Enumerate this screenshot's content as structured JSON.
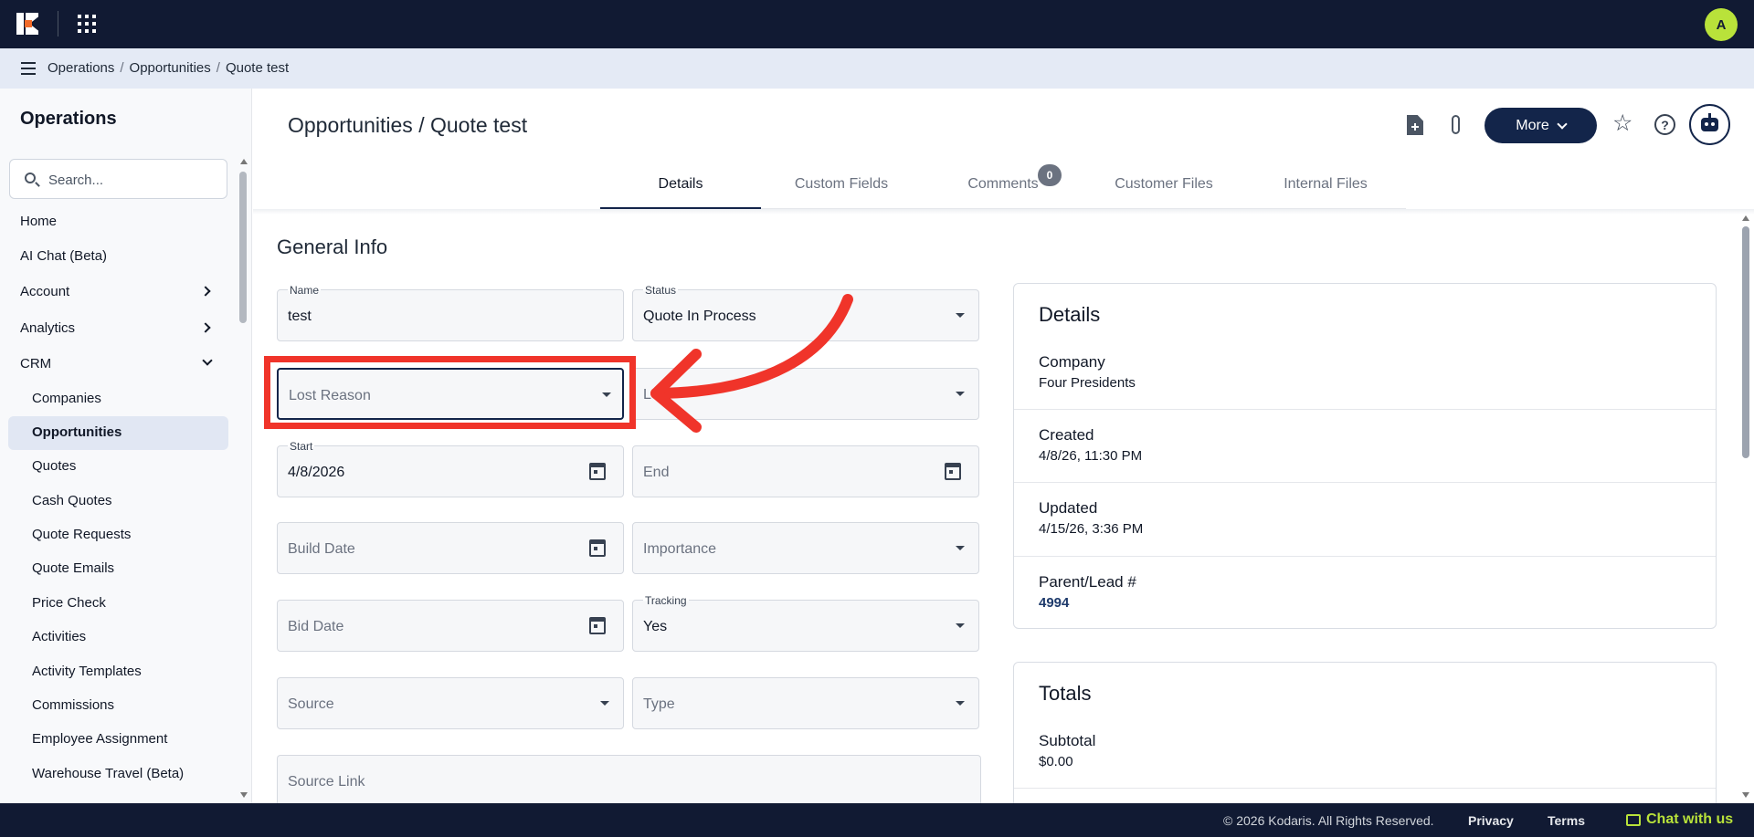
{
  "app": {
    "avatar_initial": "A"
  },
  "breadcrumb": {
    "items": [
      "Operations",
      "Opportunities",
      "Quote test"
    ],
    "sep": "/"
  },
  "sidebar": {
    "title": "Operations",
    "search_placeholder": "Search...",
    "items": [
      {
        "label": "Home"
      },
      {
        "label": "AI Chat (Beta)"
      },
      {
        "label": "Account",
        "chevron": "right"
      },
      {
        "label": "Analytics",
        "chevron": "right"
      },
      {
        "label": "CRM",
        "chevron": "down"
      }
    ],
    "crm_items": [
      "Companies",
      "Opportunities",
      "Quotes",
      "Cash Quotes",
      "Quote Requests",
      "Quote Emails",
      "Price Check",
      "Activities",
      "Activity Templates",
      "Commissions",
      "Employee Assignment",
      "Warehouse Travel (Beta)"
    ],
    "active": "Opportunities"
  },
  "header": {
    "title": "Opportunities / Quote test",
    "more_label": "More",
    "help_glyph": "?",
    "star_glyph": "☆"
  },
  "tabs": {
    "items": [
      "Details",
      "Custom Fields",
      "Comments",
      "Customer Files",
      "Internal Files"
    ],
    "active": "Details",
    "comments_count": "0"
  },
  "general_info": {
    "title": "General Info",
    "name": {
      "label": "Name",
      "value": "test"
    },
    "status": {
      "label": "Status",
      "value": "Quote In Process"
    },
    "lost_reason": {
      "placeholder": "Lost Reason"
    },
    "second_partial": {
      "placeholder": "Lo"
    },
    "start": {
      "label": "Start",
      "value": "4/8/2026"
    },
    "end": {
      "placeholder": "End"
    },
    "build_date": {
      "placeholder": "Build Date"
    },
    "importance": {
      "placeholder": "Importance"
    },
    "bid_date": {
      "placeholder": "Bid Date"
    },
    "tracking": {
      "label": "Tracking",
      "value": "Yes"
    },
    "source": {
      "placeholder": "Source"
    },
    "type": {
      "placeholder": "Type"
    },
    "source_link": {
      "placeholder": "Source Link"
    }
  },
  "details_card": {
    "title": "Details",
    "company": {
      "label": "Company",
      "value": "Four Presidents"
    },
    "created": {
      "label": "Created",
      "value": "4/8/26, 11:30 PM"
    },
    "updated": {
      "label": "Updated",
      "value": "4/15/26, 3:36 PM"
    },
    "parent": {
      "label": "Parent/Lead #",
      "value": "4994"
    }
  },
  "totals_card": {
    "title": "Totals",
    "subtotal": {
      "label": "Subtotal",
      "value": "$0.00"
    }
  },
  "footer": {
    "copyright": "© 2026 Kodaris. All Rights Reserved.",
    "privacy": "Privacy",
    "terms": "Terms",
    "chat": "Chat with us"
  },
  "colors": {
    "navy": "#111a33",
    "accent": "#13254a",
    "highlight": "#f0342a",
    "lime": "#b9e23a"
  }
}
